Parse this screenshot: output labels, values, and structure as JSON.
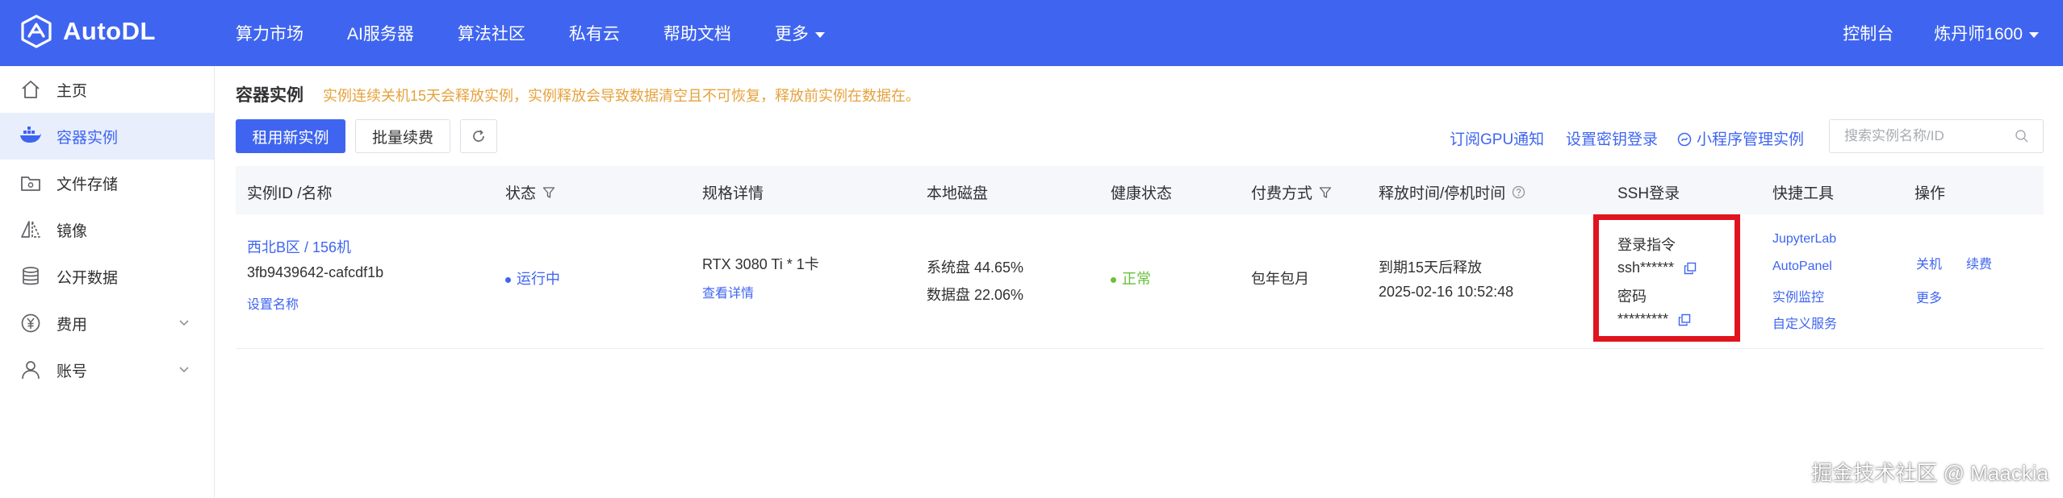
{
  "brand": {
    "name": "AutoDL"
  },
  "topnav": {
    "items": [
      "算力市场",
      "AI服务器",
      "算法社区",
      "私有云",
      "帮助文档",
      "更多"
    ],
    "console": "控制台",
    "user": "炼丹师1600"
  },
  "sidebar": {
    "items": [
      "主页",
      "容器实例",
      "文件存储",
      "镜像",
      "公开数据",
      "费用",
      "账号"
    ]
  },
  "page": {
    "title": "容器实例",
    "warning": "实例连续关机15天会释放实例，实例释放会导致数据清空且不可恢复，释放前实例在数据在。"
  },
  "toolbar": {
    "rent_button": "租用新实例",
    "batch_renew_button": "批量续费",
    "gpu_notify": "订阅GPU通知",
    "set_key_login": "设置密钥登录",
    "mini_program": "小程序管理实例",
    "search_placeholder": "搜索实例名称/ID"
  },
  "table": {
    "headers": [
      "实例ID /名称",
      "状态",
      "规格详情",
      "本地磁盘",
      "健康状态",
      "付费方式",
      "释放时间/停机时间",
      "SSH登录",
      "快捷工具",
      "操作"
    ],
    "row": {
      "name": "西北B区 / 156机",
      "id": "3fb9439642-cafcdf1b",
      "set_name": "设置名称",
      "status": "运行中",
      "spec": "RTX 3080 Ti * 1卡",
      "spec_detail": "查看详情",
      "disk_system": "系统盘 44.65%",
      "disk_data": "数据盘 22.06%",
      "health": "正常",
      "billing": "包年包月",
      "release_text": "到期15天后释放",
      "release_time": "2025-02-16 10:52:48",
      "ssh_cmd_label": "登录指令",
      "ssh_cmd": "ssh******",
      "ssh_pwd_label": "密码",
      "ssh_pwd": "*********",
      "tools": [
        "JupyterLab",
        "AutoPanel",
        "实例监控",
        "自定义服务"
      ],
      "actions": [
        "关机",
        "续费",
        "更多"
      ]
    }
  },
  "watermark": "掘金技术社区 @ Maackia",
  "colors": {
    "primary": "#3f65f0",
    "warning": "#e6a23c",
    "success": "#67c23a",
    "highlight": "#e0141e"
  }
}
